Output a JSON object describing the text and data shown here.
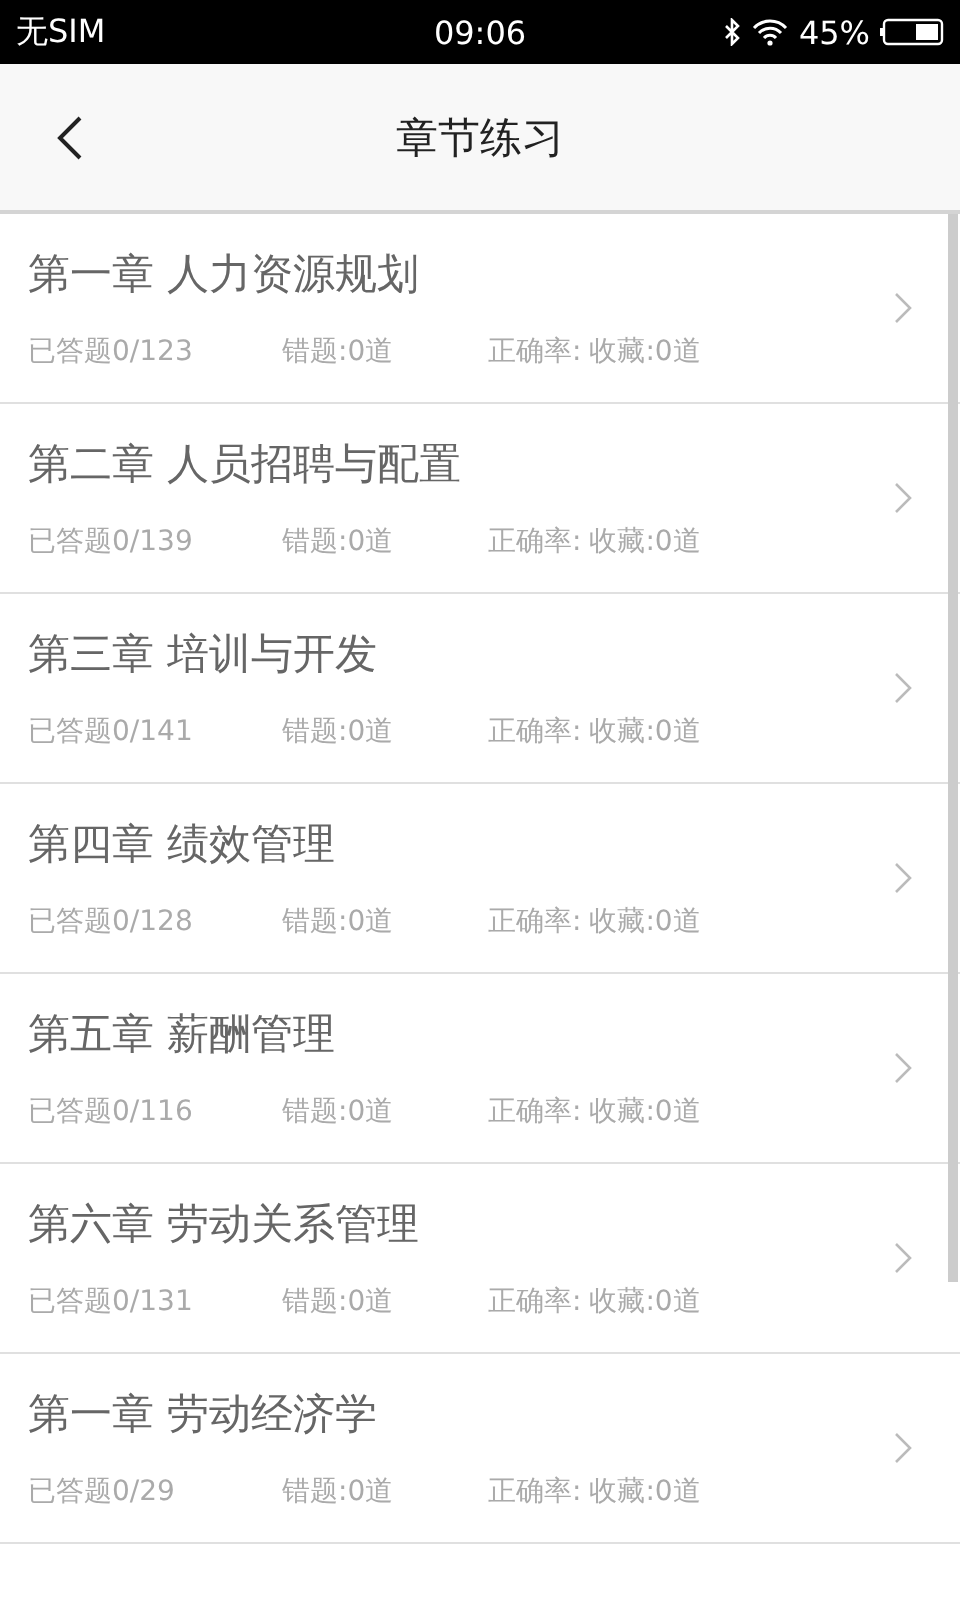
{
  "status_bar": {
    "carrier": "无SIM",
    "time": "09:06",
    "battery": "45%"
  },
  "nav": {
    "title": "章节练习"
  },
  "chapters": [
    {
      "title": "第一章 人力资源规划",
      "answered": "已答题0/123",
      "wrong": "错题:0道",
      "accuracy": "正确率:",
      "favorites": "收藏:0道"
    },
    {
      "title": "第二章 人员招聘与配置",
      "answered": "已答题0/139",
      "wrong": "错题:0道",
      "accuracy": "正确率:",
      "favorites": "收藏:0道"
    },
    {
      "title": "第三章 培训与开发",
      "answered": "已答题0/141",
      "wrong": "错题:0道",
      "accuracy": "正确率:",
      "favorites": "收藏:0道"
    },
    {
      "title": "第四章 绩效管理",
      "answered": "已答题0/128",
      "wrong": "错题:0道",
      "accuracy": "正确率:",
      "favorites": "收藏:0道"
    },
    {
      "title": "第五章 薪酬管理",
      "answered": "已答题0/116",
      "wrong": "错题:0道",
      "accuracy": "正确率:",
      "favorites": "收藏:0道"
    },
    {
      "title": "第六章 劳动关系管理",
      "answered": "已答题0/131",
      "wrong": "错题:0道",
      "accuracy": "正确率:",
      "favorites": "收藏:0道"
    },
    {
      "title": "第一章 劳动经济学",
      "answered": "已答题0/29",
      "wrong": "错题:0道",
      "accuracy": "正确率:",
      "favorites": "收藏:0道"
    }
  ]
}
